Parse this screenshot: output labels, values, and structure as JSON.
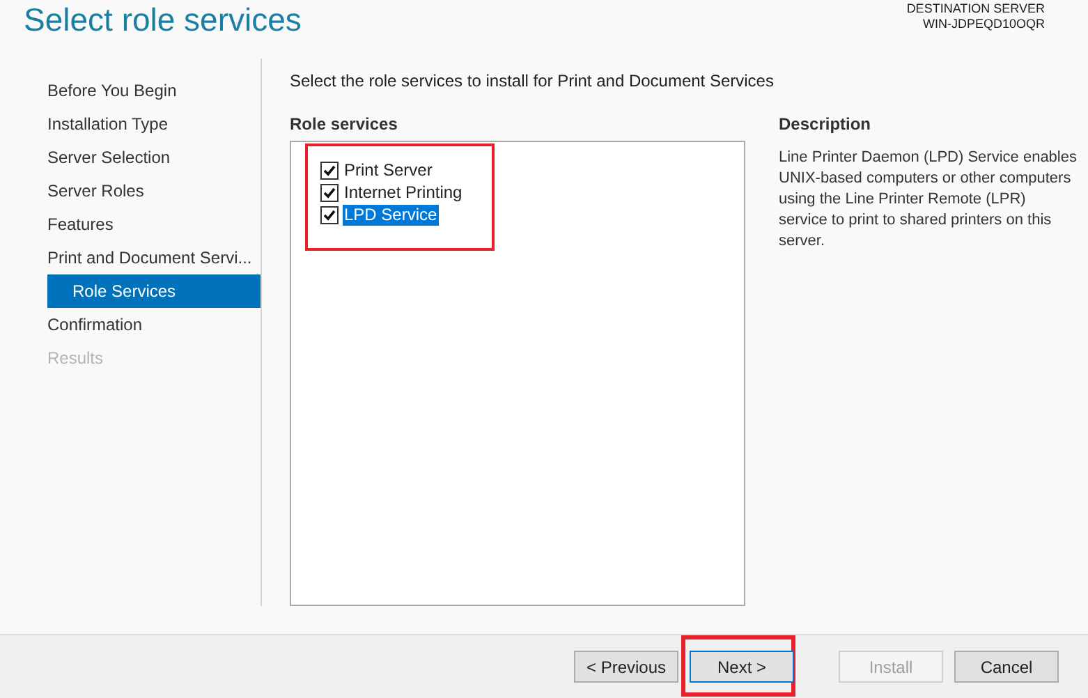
{
  "header": {
    "title": "Select role services",
    "destination_label": "DESTINATION SERVER",
    "destination_server": "WIN-JDPEQD10OQR"
  },
  "steps": [
    {
      "label": "Before You Begin",
      "selected": false,
      "disabled": false,
      "sub": false
    },
    {
      "label": "Installation Type",
      "selected": false,
      "disabled": false,
      "sub": false
    },
    {
      "label": "Server Selection",
      "selected": false,
      "disabled": false,
      "sub": false
    },
    {
      "label": "Server Roles",
      "selected": false,
      "disabled": false,
      "sub": false
    },
    {
      "label": "Features",
      "selected": false,
      "disabled": false,
      "sub": false
    },
    {
      "label": "Print and Document Servi...",
      "selected": false,
      "disabled": false,
      "sub": false
    },
    {
      "label": "Role Services",
      "selected": true,
      "disabled": false,
      "sub": true
    },
    {
      "label": "Confirmation",
      "selected": false,
      "disabled": false,
      "sub": false
    },
    {
      "label": "Results",
      "selected": false,
      "disabled": true,
      "sub": false
    }
  ],
  "instruction": "Select the role services to install for Print and Document Services",
  "role_services": {
    "heading": "Role services",
    "highlighted": true,
    "items": [
      {
        "label": "Print Server",
        "checked": true,
        "selected": false
      },
      {
        "label": "Internet Printing",
        "checked": true,
        "selected": false
      },
      {
        "label": "LPD Service",
        "checked": true,
        "selected": true
      }
    ]
  },
  "description": {
    "heading": "Description",
    "text": "Line Printer Daemon (LPD) Service enables UNIX-based computers or other computers using the Line Printer Remote (LPR) service to print to shared printers on this server."
  },
  "buttons": [
    {
      "label": "< Previous",
      "disabled": false,
      "focused": false,
      "highlighted": false
    },
    {
      "label": "Next >",
      "disabled": false,
      "focused": true,
      "highlighted": true
    },
    {
      "label": "Install",
      "disabled": true,
      "focused": false,
      "highlighted": false
    },
    {
      "label": "Cancel",
      "disabled": false,
      "focused": false,
      "highlighted": false
    }
  ]
}
